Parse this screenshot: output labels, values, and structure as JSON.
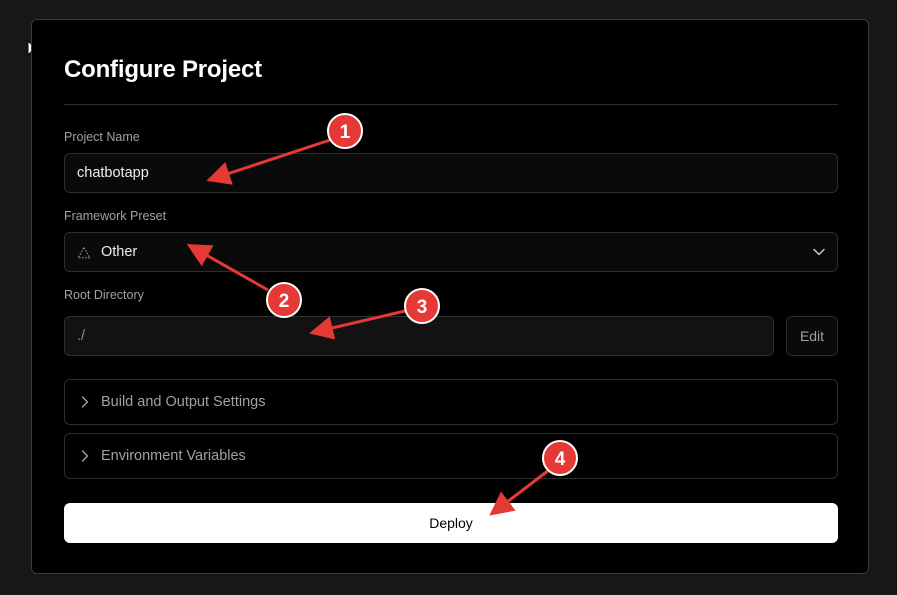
{
  "form": {
    "title": "Configure Project",
    "project_name": {
      "label": "Project Name",
      "value": "chatbotapp"
    },
    "framework_preset": {
      "label": "Framework Preset",
      "value": "Other",
      "icon": "triangle-icon"
    },
    "root_directory": {
      "label": "Root Directory",
      "value": "./",
      "edit_label": "Edit"
    },
    "sections": [
      {
        "label": "Build and Output Settings",
        "icon": "chevron-right-icon"
      },
      {
        "label": "Environment Variables",
        "icon": "chevron-right-icon"
      }
    ],
    "deploy_label": "Deploy"
  },
  "annotations": {
    "color": "#e53935",
    "markers": [
      "1",
      "2",
      "3",
      "4"
    ]
  }
}
